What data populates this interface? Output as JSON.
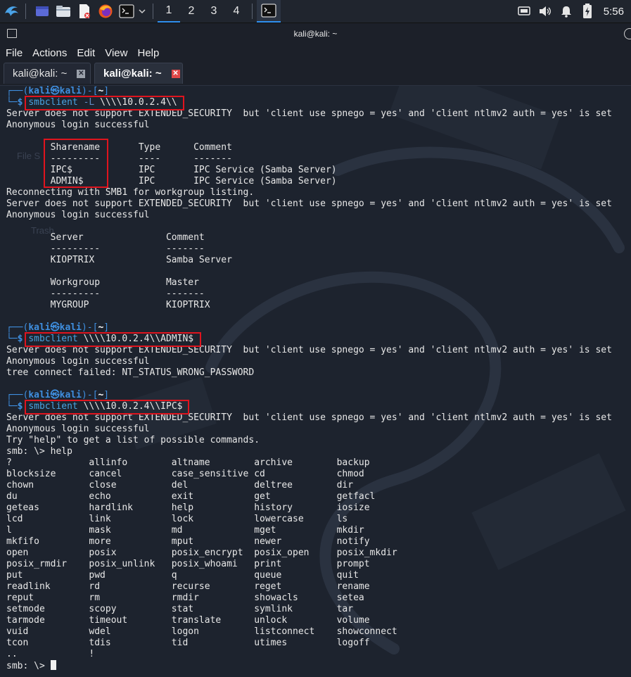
{
  "taskbar": {
    "workspaces": [
      "1",
      "2",
      "3",
      "4"
    ],
    "clock": "5:56"
  },
  "window": {
    "title": "kali@kali: ~"
  },
  "menu": [
    "File",
    "Actions",
    "Edit",
    "View",
    "Help"
  ],
  "tabs": [
    {
      "label": "kali@kali: ~",
      "active": false
    },
    {
      "label": "kali@kali: ~",
      "active": true
    }
  ],
  "desktop_ghost": {
    "file_system": "File S",
    "trash": "Trash"
  },
  "terminal": {
    "prompt": {
      "user": "kali",
      "at": "㉿",
      "host": "kali",
      "path": "~"
    },
    "command_1": {
      "name": "smbclient",
      "flag": "-L",
      "target": "\\\\\\\\10.0.2.4\\\\"
    },
    "output_1": [
      "Server does not support EXTENDED_SECURITY  but 'client use spnego = yes' and 'client ntlmv2 auth = yes' is set",
      "Anonymous login successful",
      "",
      "        Sharename       Type      Comment",
      "        ---------       ----      -------",
      "        IPC$            IPC       IPC Service (Samba Server)",
      "        ADMIN$          IPC       IPC Service (Samba Server)",
      "Reconnecting with SMB1 for workgroup listing.",
      "Server does not support EXTENDED_SECURITY  but 'client use spnego = yes' and 'client ntlmv2 auth = yes' is set",
      "Anonymous login successful",
      "",
      "        Server               Comment",
      "        ---------            -------",
      "        KIOPTRIX             Samba Server",
      "",
      "        Workgroup            Master",
      "        ---------            -------",
      "        MYGROUP              KIOPTRIX",
      ""
    ],
    "command_2": {
      "name": "smbclient",
      "target": "\\\\\\\\10.0.2.4\\\\ADMIN$"
    },
    "output_2": [
      "Server does not support EXTENDED_SECURITY  but 'client use spnego = yes' and 'client ntlmv2 auth = yes' is set",
      "Anonymous login successful",
      "tree connect failed: NT_STATUS_WRONG_PASSWORD",
      ""
    ],
    "command_3": {
      "name": "smbclient",
      "target": "\\\\\\\\10.0.2.4\\\\IPC$"
    },
    "output_3": [
      "Server does not support EXTENDED_SECURITY  but 'client use spnego = yes' and 'client ntlmv2 auth = yes' is set",
      "Anonymous login successful",
      "Try \"help\" to get a list of possible commands.",
      "smb: \\> help",
      "?              allinfo        altname        archive        backup",
      "blocksize      cancel         case_sensitive cd             chmod",
      "chown          close          del            deltree        dir",
      "du             echo           exit           get            getfacl",
      "geteas         hardlink       help           history        iosize",
      "lcd            link           lock           lowercase      ls",
      "l              mask           md             mget           mkdir",
      "mkfifo         more           mput           newer          notify",
      "open           posix          posix_encrypt  posix_open     posix_mkdir",
      "posix_rmdir    posix_unlink   posix_whoami   print          prompt",
      "put            pwd            q              queue          quit",
      "readlink       rd             recurse        reget          rename",
      "reput          rm             rmdir          showacls       setea",
      "setmode        scopy          stat           symlink        tar",
      "tarmode        timeout        translate      unlock         volume",
      "vuid           wdel           logon          listconnect    showconnect",
      "tcon           tdis           tid            utimes         logoff",
      "..             !"
    ],
    "final_prompt": "smb: \\> "
  }
}
